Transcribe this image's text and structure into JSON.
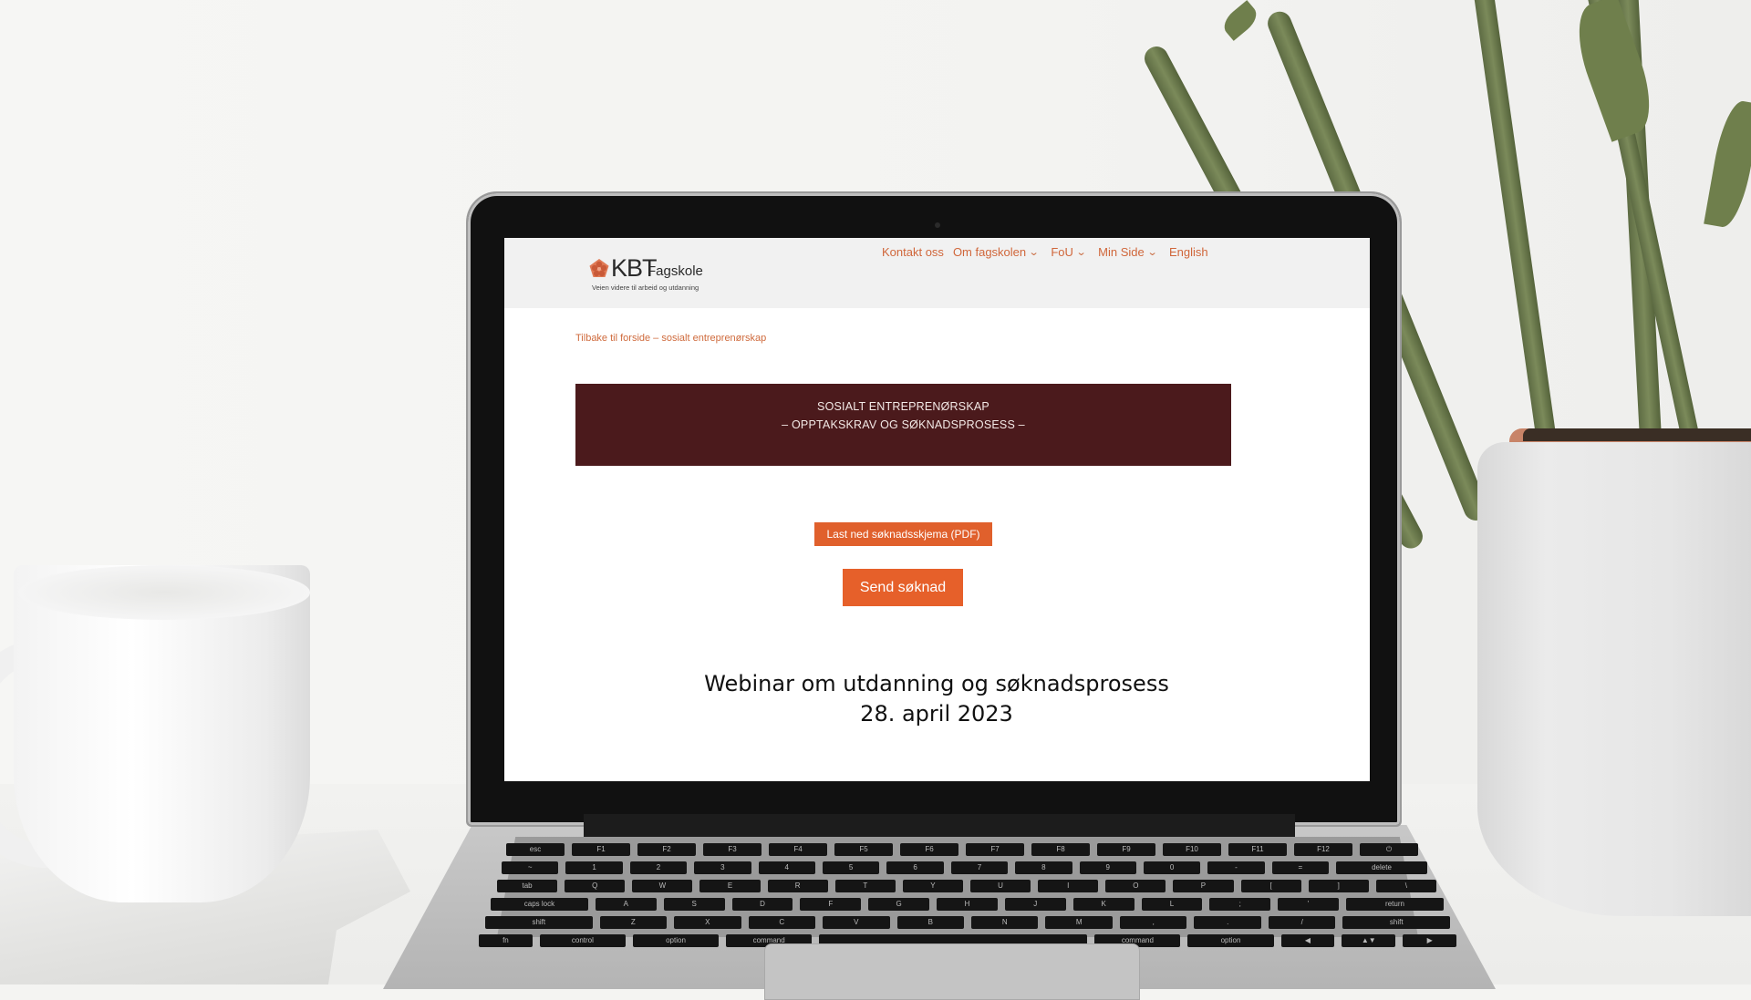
{
  "site": {
    "logo": {
      "brand": "KBT",
      "name": "Fagskole",
      "tagline": "Veien videre til arbeid og utdanning"
    },
    "nav": [
      {
        "label": "Kontakt oss",
        "has_dropdown": false
      },
      {
        "label": "Om fagskolen",
        "has_dropdown": true
      },
      {
        "label": "FoU",
        "has_dropdown": true
      },
      {
        "label": "Min Side",
        "has_dropdown": true
      },
      {
        "label": "English",
        "has_dropdown": false
      }
    ],
    "chevron_glyph": "⌄"
  },
  "main": {
    "breadcrumb": "Tilbake til forside – sosialt entreprenørskap",
    "banner": {
      "line1": "SOSIALT ENTREPRENØRSKAP",
      "line2": "– OPPTAKSKRAV OG SØKNADSPROSESS –"
    },
    "download_button": "Last ned søknadsskjema (PDF)",
    "send_button": "Send søknad",
    "webinar": {
      "title": "Webinar om utdanning og søknadsprosess",
      "date": "28. april 2023"
    }
  },
  "colors": {
    "accent": "#e0602c",
    "link": "#cf6a3c",
    "banner_bg": "#4b1a1c",
    "header_bg": "#f1f1f1"
  },
  "keyboard": {
    "rows": [
      [
        "esc",
        "F1",
        "F2",
        "F3",
        "F4",
        "F5",
        "F6",
        "F7",
        "F8",
        "F9",
        "F10",
        "F11",
        "F12",
        "⏻"
      ],
      [
        "~",
        "1",
        "2",
        "3",
        "4",
        "5",
        "6",
        "7",
        "8",
        "9",
        "0",
        "-",
        "=",
        "delete"
      ],
      [
        "tab",
        "Q",
        "W",
        "E",
        "R",
        "T",
        "Y",
        "U",
        "I",
        "O",
        "P",
        "[",
        "]",
        "\\"
      ],
      [
        "caps lock",
        "A",
        "S",
        "D",
        "F",
        "G",
        "H",
        "J",
        "K",
        "L",
        ";",
        "'",
        "return"
      ],
      [
        "shift",
        "Z",
        "X",
        "C",
        "V",
        "B",
        "N",
        "M",
        ",",
        ".",
        "/",
        "shift"
      ],
      [
        "fn",
        "control",
        "option",
        "command",
        "",
        "command",
        "option",
        "◀",
        "▲▼",
        "▶"
      ]
    ]
  }
}
